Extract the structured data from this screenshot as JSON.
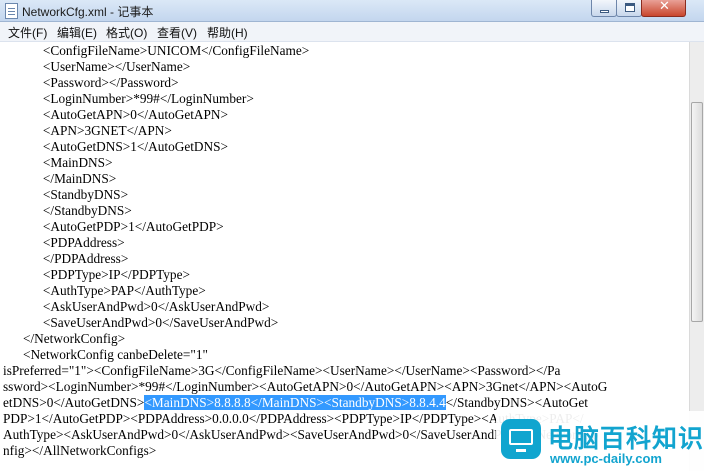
{
  "window": {
    "title": "NetworkCfg.xml - 记事本",
    "close_glyph": "✕"
  },
  "menu": [
    "文件(F)",
    "编辑(E)",
    "格式(O)",
    "查看(V)",
    "帮助(H)"
  ],
  "editor_lines": [
    {
      "text": "            <ConfigFileName>UNICOM</ConfigFileName>"
    },
    {
      "text": "            <UserName></UserName>"
    },
    {
      "text": "            <Password></Password>"
    },
    {
      "text": "            <LoginNumber>*99#</LoginNumber>"
    },
    {
      "text": "            <AutoGetAPN>0</AutoGetAPN>"
    },
    {
      "text": "            <APN>3GNET</APN>"
    },
    {
      "text": "            <AutoGetDNS>1</AutoGetDNS>"
    },
    {
      "text": "            <MainDNS>"
    },
    {
      "text": "            </MainDNS>"
    },
    {
      "text": "            <StandbyDNS>"
    },
    {
      "text": "            </StandbyDNS>"
    },
    {
      "text": "            <AutoGetPDP>1</AutoGetPDP>"
    },
    {
      "text": "            <PDPAddress>"
    },
    {
      "text": "            </PDPAddress>"
    },
    {
      "text": "            <PDPType>IP</PDPType>"
    },
    {
      "text": "            <AuthType>PAP</AuthType>"
    },
    {
      "text": "            <AskUserAndPwd>0</AskUserAndPwd>"
    },
    {
      "text": "            <SaveUserAndPwd>0</SaveUserAndPwd>"
    },
    {
      "text": "      </NetworkConfig>"
    },
    {
      "text": "      <NetworkConfig canbeDelete=\"1\""
    },
    {
      "text": "isPreferred=\"1\"><ConfigFileName>3G</ConfigFileName><UserName></UserName><Password></Pa"
    },
    {
      "text": "ssword><LoginNumber>*99#</LoginNumber><AutoGetAPN>0</AutoGetAPN><APN>3Gnet</APN><AutoG"
    },
    {
      "text": "etDNS>0</AutoGetDNS>",
      "selected": "<MainDNS>8.8.8.8</MainDNS><StandbyDNS>8.8.4.4",
      "after": "</StandbyDNS><AutoGet"
    },
    {
      "text": "PDP>1</AutoGetPDP><PDPAddress>0.0.0.0</PDPAddress><PDPType>IP</PDPType><AuthType>PAP</"
    },
    {
      "text": "AuthType><AskUserAndPwd>0</AskUserAndPwd><SaveUserAndPwd>0</SaveUserAndPwd></NetworkCo"
    },
    {
      "text": "nfig></AllNetworkConfigs>"
    }
  ],
  "watermark": {
    "title": "电脑百科知识",
    "url": "www.pc-daily.com",
    "color": "#12a4cf"
  },
  "selection_color": "#3399ff"
}
